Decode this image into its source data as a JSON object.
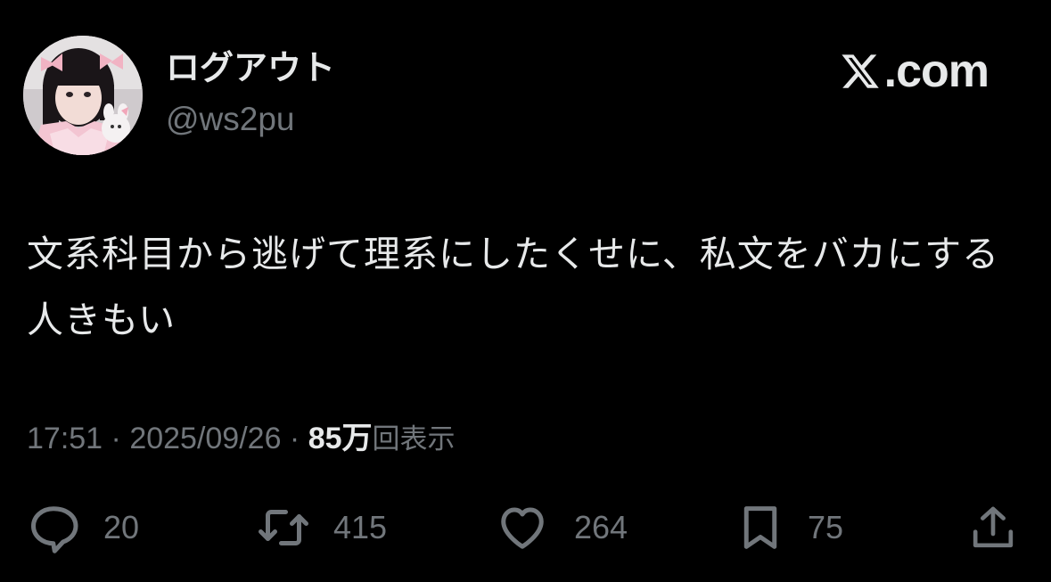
{
  "header": {
    "display_name": "ログアウト",
    "handle": "@ws2pu",
    "brand": {
      "icon": "x-logo-icon",
      "text": ".com"
    }
  },
  "tweet": {
    "text": "文系科目から逃げて理系にしたくせに、私文をバカにする人きもい"
  },
  "meta": {
    "time": "17:51",
    "separator": " · ",
    "date": "2025/09/26",
    "views_count": "85万",
    "views_label": "回表示"
  },
  "actions": {
    "reply": {
      "icon": "reply-icon",
      "count": "20"
    },
    "retweet": {
      "icon": "retweet-icon",
      "count": "415"
    },
    "like": {
      "icon": "heart-icon",
      "count": "264"
    },
    "bookmark": {
      "icon": "bookmark-icon",
      "count": "75"
    },
    "share": {
      "icon": "share-icon"
    }
  },
  "colors": {
    "background": "#000000",
    "primary_text": "#e7e9ea",
    "secondary_text": "#71767b"
  }
}
